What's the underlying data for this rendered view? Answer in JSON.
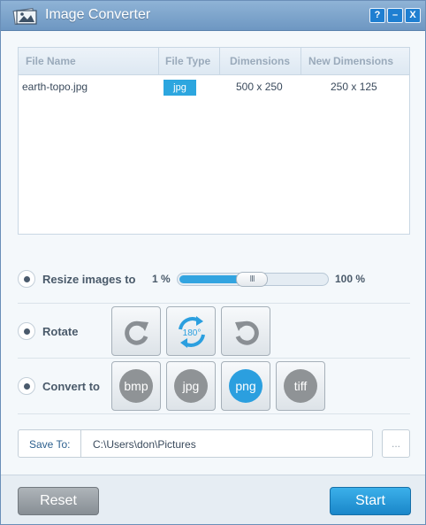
{
  "window": {
    "title": "Image Converter",
    "help_label": "?",
    "minimize_label": "–",
    "close_label": "X"
  },
  "file_table": {
    "columns": [
      "File Name",
      "File Type",
      "Dimensions",
      "New Dimensions"
    ],
    "rows": [
      {
        "file_name": "earth-topo.jpg",
        "file_type": "jpg",
        "dimensions": "500 x 250",
        "new_dimensions": "250 x 125"
      }
    ]
  },
  "resize": {
    "label": "Resize images to",
    "min_label": "1 %",
    "max_label": "100 %",
    "value_percent": 50,
    "thumb_grip": "III"
  },
  "rotate": {
    "label": "Rotate",
    "options": [
      {
        "name": "rotate-right-icon"
      },
      {
        "name": "rotate-180-icon",
        "label": "180°"
      },
      {
        "name": "rotate-left-icon"
      }
    ]
  },
  "convert": {
    "label": "Convert to",
    "formats": [
      "bmp",
      "jpg",
      "png",
      "tiff"
    ],
    "selected": "png"
  },
  "save": {
    "label": "Save To:",
    "path": "C:\\Users\\don\\Pictures",
    "browse_label": "..."
  },
  "actions": {
    "reset_label": "Reset",
    "start_label": "Start"
  },
  "colors": {
    "accent": "#2b9fdf",
    "titlebar": "#7aa1c9"
  }
}
